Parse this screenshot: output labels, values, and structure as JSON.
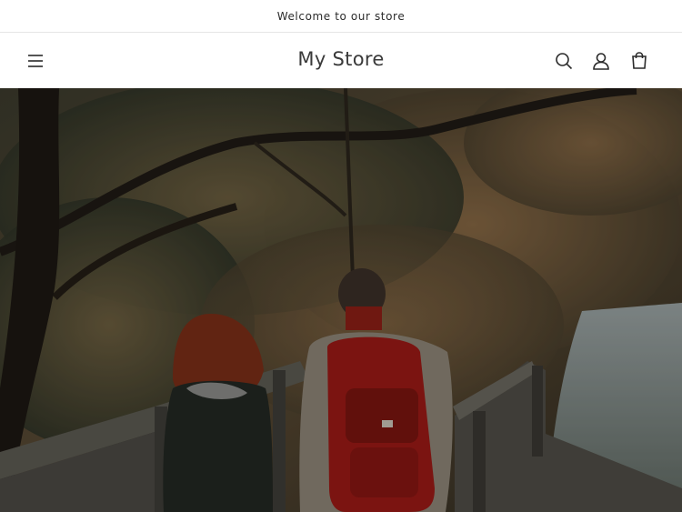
{
  "announcement": {
    "text": "Welcome to our store"
  },
  "header": {
    "logo": "My Store",
    "icons": {
      "menu": "hamburger-menu-icon",
      "search": "search-icon",
      "account": "account-icon",
      "cart": "cart-icon"
    }
  },
  "hero": {
    "image": "autumn-forest-couple-walking-bridge"
  },
  "colors": {
    "header_bg": "#ffffff",
    "text": "#121212",
    "hero_dark": "#2b2418"
  }
}
